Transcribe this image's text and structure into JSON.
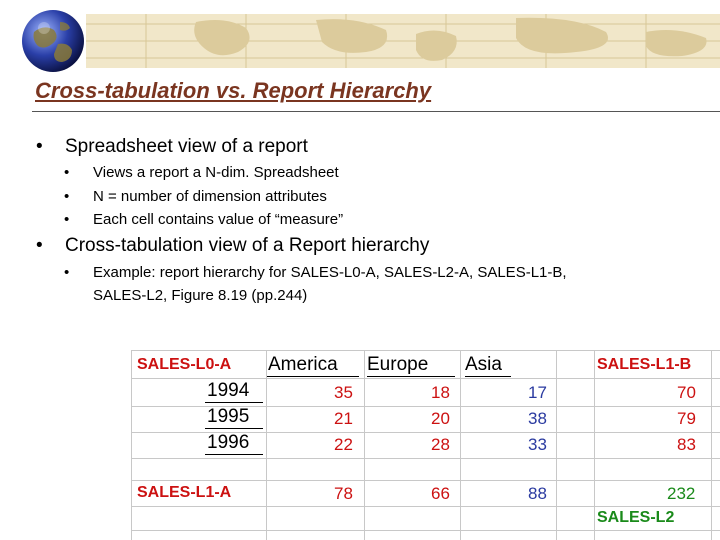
{
  "slide": {
    "title": "Cross-tabulation vs. Report Hierarchy",
    "bullet_glyph": "•",
    "bullets": [
      {
        "text": "Spreadsheet view of a report",
        "sub": [
          "Views a report a N-dim. Spreadsheet",
          "N = number of dimension attributes",
          "Each cell contains value of “measure”"
        ]
      },
      {
        "text": "Cross-tabulation view of a Report hierarchy",
        "sub": [
          "Example: report hierarchy for SALES-L0-A, SALES-L2-A, SALES-L1-B,",
          "SALES-L2, Figure 8.19 (pp.244)"
        ]
      }
    ]
  },
  "sheet": {
    "corner": "SALES-L0-A",
    "columns": [
      "America",
      "Europe",
      "Asia"
    ],
    "total_col_label": "SALES-L1-B",
    "rows": [
      {
        "label": "1994",
        "values": [
          "35",
          "18",
          "17"
        ],
        "total": "70"
      },
      {
        "label": "1995",
        "values": [
          "21",
          "20",
          "38"
        ],
        "total": "79"
      },
      {
        "label": "1996",
        "values": [
          "22",
          "28",
          "33"
        ],
        "total": "83"
      }
    ],
    "total_row_label": "SALES-L1-A",
    "total_row_values": [
      "78",
      "66",
      "88"
    ],
    "grand_total": "232",
    "grand_total_label": "SALES-L2"
  },
  "colors": {
    "title": "#7a3520",
    "red": "#cc1111",
    "blue": "#2a3aa0",
    "green": "#1a8a1a",
    "banner": "#f1e7c9"
  },
  "icons": {
    "globe": "globe-icon",
    "banner": "world-map-banner"
  }
}
